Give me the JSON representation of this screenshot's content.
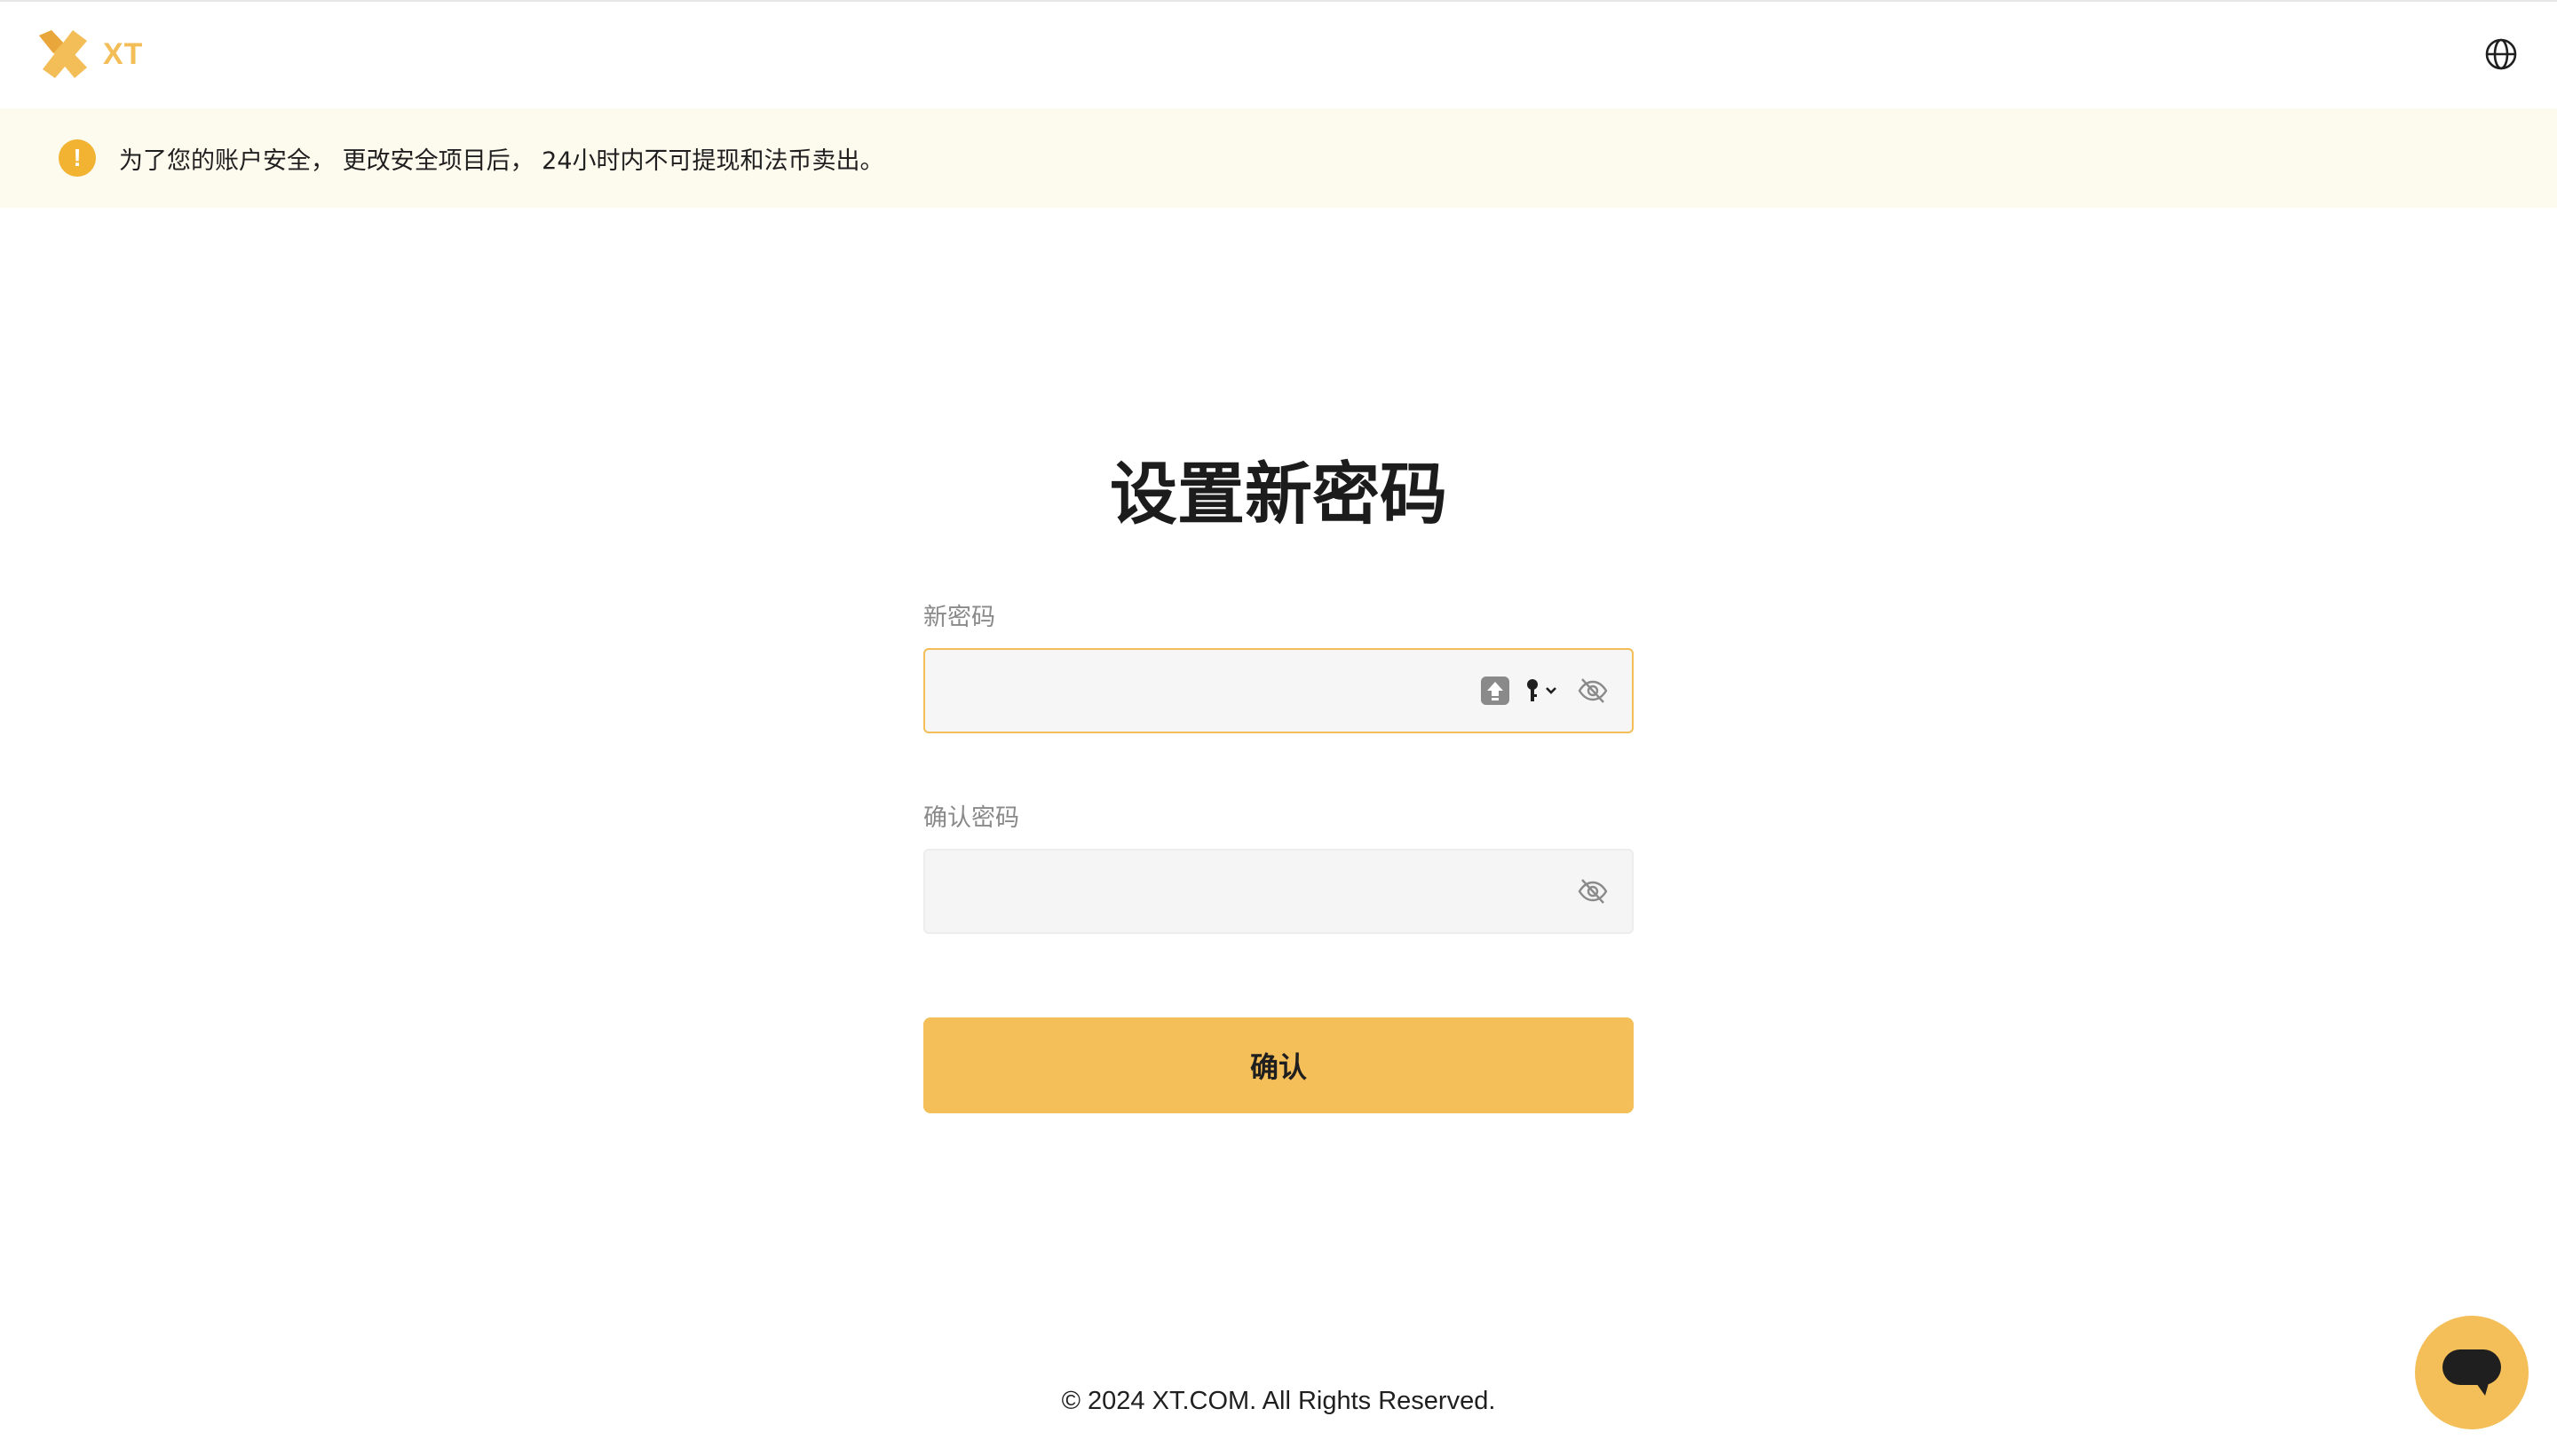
{
  "header": {
    "logo_text": "XT",
    "logo_icon": "xt-logo-icon",
    "language_icon": "globe-icon"
  },
  "notice": {
    "icon": "warning-icon",
    "icon_glyph": "!",
    "text": "为了您的账户安全， 更改安全项目后， 24小时内不可提现和法币卖出。"
  },
  "form": {
    "title": "设置新密码",
    "new_password": {
      "label": "新密码",
      "value": "",
      "icons": [
        "caps-lock-icon",
        "password-key-icon",
        "eye-off-icon"
      ]
    },
    "confirm_password": {
      "label": "确认密码",
      "value": "",
      "icons": [
        "eye-off-icon"
      ]
    },
    "submit_label": "确认"
  },
  "footer": {
    "copyright": "© 2024 XT.COM. All Rights Reserved."
  },
  "chat": {
    "icon": "chat-bubble-icon"
  },
  "colors": {
    "accent": "#f4be58",
    "notice_bg": "#fdfaee",
    "warning": "#f2b232",
    "label": "#8a8a8a",
    "field_bg": "#f5f5f5"
  }
}
